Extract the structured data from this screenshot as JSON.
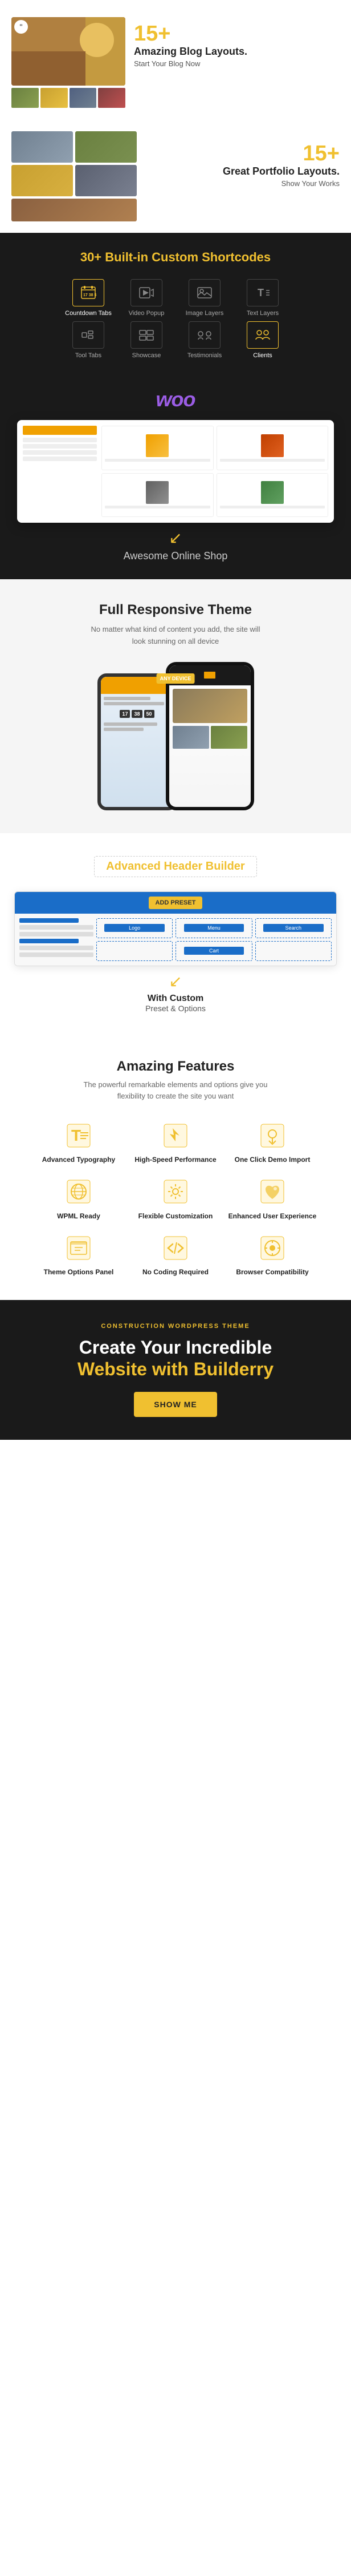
{
  "blog": {
    "number": "15+",
    "title": "Amazing Blog Layouts.",
    "desc": "Start Your Blog Now"
  },
  "portfolio": {
    "number": "15+",
    "title": "Great Portfolio Layouts.",
    "desc": "Show Your Works"
  },
  "shortcodes": {
    "title_plain": "30+ Built-in ",
    "title_highlight": "Custom",
    "title_end": " Shortcodes",
    "items": [
      {
        "icon": "⏱",
        "label": "Countdown Tabs",
        "active": true
      },
      {
        "icon": "▶",
        "label": "Video Popup",
        "active": false
      },
      {
        "icon": "🖼",
        "label": "Image Layers",
        "active": false
      },
      {
        "icon": "T",
        "label": "Text Layers",
        "active": false
      },
      {
        "icon": "🔧",
        "label": "Tool Tabs",
        "active": false
      },
      {
        "icon": "⊞",
        "label": "Showcase",
        "active": false
      },
      {
        "icon": "★",
        "label": "Testimonials",
        "active": false
      },
      {
        "icon": "👥",
        "label": "Clients",
        "active": true
      }
    ]
  },
  "woocommerce": {
    "logo": "WOO",
    "label_awesome": "Awesome",
    "label_online_shop": "Online Shop"
  },
  "responsive": {
    "title": "Full Responsive Theme",
    "desc": "No matter what kind of content you add, the site will look stunning on all device",
    "badge": "ANY DEVICE"
  },
  "header_builder": {
    "title_pre": "",
    "title_highlight": "Advanced",
    "title_post": " Header Builder",
    "add_btn": "ADD PRESET",
    "subtitle": "With Custom",
    "subtitle2": "Preset & Options"
  },
  "features": {
    "title": "Amazing Features",
    "desc": "The powerful remarkable elements and options give you flexibility to create the site you want",
    "items": [
      {
        "icon": "T",
        "name": "Advanced Typography",
        "color": "#f0c030"
      },
      {
        "icon": "⚡",
        "name": "High-Speed Performance",
        "color": "#f0c030"
      },
      {
        "icon": "↓",
        "name": "One Click Demo Import",
        "color": "#f0c030"
      },
      {
        "icon": "🌐",
        "name": "WPML Ready",
        "color": "#f0c030"
      },
      {
        "icon": "⚙",
        "name": "Flexible Customization",
        "color": "#f0c030"
      },
      {
        "icon": "👆",
        "name": "Enhanced User Experience",
        "color": "#f0c030"
      },
      {
        "icon": "⊞",
        "name": "Theme Options Panel",
        "color": "#f0c030"
      },
      {
        "icon": "</>",
        "name": "No Coding Required",
        "color": "#f0c030"
      },
      {
        "icon": "🌍",
        "name": "Browser Compatibility",
        "color": "#f0c030"
      }
    ]
  },
  "cta": {
    "tag": "CONSTRUCTION WORDPRESS THEME",
    "title_line1": "Create Your Incredible",
    "title_line2": "Website with ",
    "title_highlight": "Builderry",
    "button_label": "SHOW ME"
  }
}
